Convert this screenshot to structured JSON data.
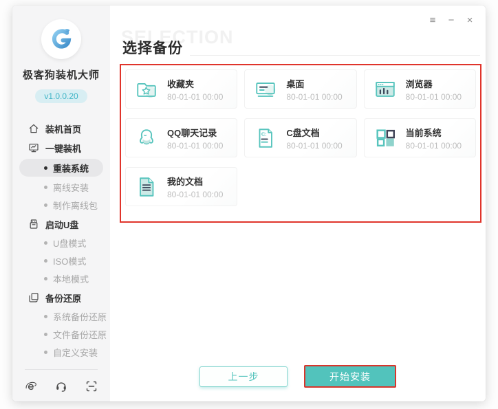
{
  "colors": {
    "accent_teal": "#52c3bc",
    "icon_teal_light": "#c2e5e1",
    "highlight_red": "#e0342b",
    "sidebar_bg": "#f5f5f6",
    "version_pill_bg": "#d8eef3",
    "version_pill_text": "#3fb4c6"
  },
  "sidebar": {
    "app_name": "极客狗装机大师",
    "version": "v1.0.0.20",
    "items": [
      {
        "slug": "install-home",
        "label": "装机首页",
        "level": "top",
        "icon": "home-icon",
        "active": false
      },
      {
        "slug": "one-key-install",
        "label": "一键装机",
        "level": "top",
        "icon": "monitor-install-icon",
        "active": false
      },
      {
        "slug": "reinstall-system",
        "label": "重装系统",
        "level": "sub",
        "active": true
      },
      {
        "slug": "offline-install",
        "label": "离线安装",
        "level": "sub",
        "active": false
      },
      {
        "slug": "make-offline-pack",
        "label": "制作离线包",
        "level": "sub",
        "active": false
      },
      {
        "slug": "boot-usb",
        "label": "启动U盘",
        "level": "top",
        "icon": "usb-drive-icon",
        "active": false
      },
      {
        "slug": "usb-mode",
        "label": "U盘模式",
        "level": "sub",
        "active": false
      },
      {
        "slug": "iso-mode",
        "label": "ISO模式",
        "level": "sub",
        "active": false
      },
      {
        "slug": "local-mode",
        "label": "本地模式",
        "level": "sub",
        "active": false
      },
      {
        "slug": "backup-restore",
        "label": "备份还原",
        "level": "top",
        "icon": "backup-restore-icon",
        "active": false
      },
      {
        "slug": "system-backup-restore",
        "label": "系统备份还原",
        "level": "sub",
        "active": false
      },
      {
        "slug": "file-backup-restore",
        "label": "文件备份还原",
        "level": "sub",
        "active": false
      },
      {
        "slug": "custom-install",
        "label": "自定义安装",
        "level": "sub",
        "active": false
      }
    ],
    "footer_icons": [
      {
        "name": "ie-browser-icon"
      },
      {
        "name": "support-headset-icon"
      },
      {
        "name": "qr-scan-icon"
      }
    ]
  },
  "window_controls": {
    "menu": "≡",
    "minimize": "−",
    "close": "×"
  },
  "main": {
    "watermark": "SELECTION",
    "title": "选择备份",
    "backup_items": [
      {
        "slug": "favorites",
        "name": "收藏夹",
        "time": "80-01-01 00:00",
        "icon": "favorites-folder-icon"
      },
      {
        "slug": "desktop",
        "name": "桌面",
        "time": "80-01-01 00:00",
        "icon": "desktop-icon"
      },
      {
        "slug": "browser",
        "name": "浏览器",
        "time": "80-01-01 00:00",
        "icon": "browser-icon"
      },
      {
        "slug": "qq-chat-history",
        "name": "QQ聊天记录",
        "time": "80-01-01 00:00",
        "icon": "qq-icon"
      },
      {
        "slug": "c-drive-docs",
        "name": "C盘文档",
        "time": "80-01-01 00:00",
        "icon": "c-drive-doc-icon"
      },
      {
        "slug": "current-system",
        "name": "当前系统",
        "time": "80-01-01 00:00",
        "icon": "current-system-icon"
      },
      {
        "slug": "my-documents",
        "name": "我的文档",
        "time": "80-01-01 00:00",
        "icon": "my-documents-icon"
      }
    ],
    "buttons": {
      "prev": "上一步",
      "start": "开始安装"
    }
  }
}
